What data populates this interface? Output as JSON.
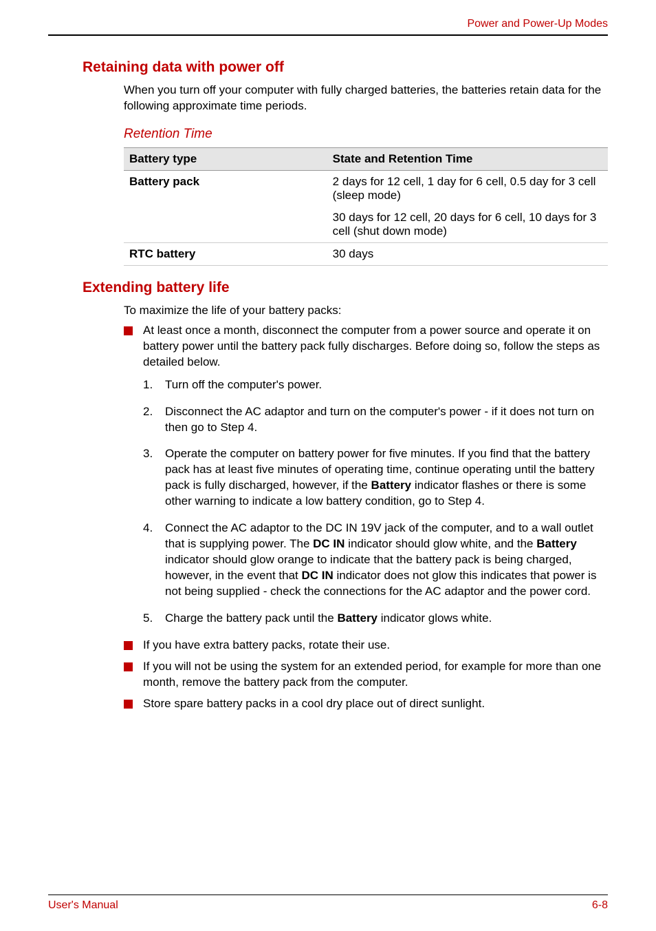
{
  "header": {
    "section_title": "Power and Power-Up Modes"
  },
  "sections": {
    "s1": {
      "heading": "Retaining data with power off",
      "intro": "When you turn off your computer with fully charged batteries, the batteries retain data for the following approximate time periods.",
      "sub_heading": "Retention Time",
      "table": {
        "headers": {
          "c1": "Battery type",
          "c2": "State and Retention Time"
        },
        "rows": {
          "r1": {
            "c1": "Battery pack",
            "c2a": "2 days for 12 cell, 1 day for 6 cell, 0.5 day for 3 cell (sleep mode)",
            "c2b": "30 days for 12 cell, 20 days for 6 cell, 10 days for 3 cell (shut down mode)"
          },
          "r2": {
            "c1": "RTC battery",
            "c2": "30 days"
          }
        }
      }
    },
    "s2": {
      "heading": "Extending battery life",
      "intro": "To maximize the life of your battery packs:",
      "bullets": {
        "b1_pre": "At least once a month, disconnect the computer from a power source and operate it on battery power until the battery pack fully discharges. Before doing so, follow the steps as detailed below.",
        "n1": "Turn off the computer's power.",
        "n2": "Disconnect the AC adaptor and turn on the computer's power - if it does not turn on then go to Step 4.",
        "n3_pre": "Operate the computer on battery power for five minutes. If you find that the battery pack has at least five minutes of operating time, continue operating until the battery pack is fully discharged, however, if the ",
        "n3_bold1": "Battery",
        "n3_post": " indicator flashes or there is some other warning to indicate a low battery condition, go to Step 4.",
        "n4_pre": "Connect the AC adaptor to the DC IN 19V jack of the computer, and to a wall outlet that is supplying power. The ",
        "n4_b1": "DC IN",
        "n4_mid1": " indicator should glow white, and the ",
        "n4_b2": "Battery",
        "n4_mid2": " indicator should glow orange to indicate that the battery pack is being charged, however, in the event that ",
        "n4_b3": "DC IN",
        "n4_post": " indicator does not glow this indicates that power is not being supplied - check the connections for the AC adaptor and the power cord.",
        "n5_pre": "Charge the battery pack until the ",
        "n5_b1": "Battery",
        "n5_post": " indicator glows white.",
        "b2": "If you have extra battery packs, rotate their use.",
        "b3": "If you will not be using the system for an extended period, for example for more than one month, remove the battery pack from the computer.",
        "b4": "Store spare battery packs in a cool dry place out of direct sunlight."
      }
    }
  },
  "footer": {
    "left": "User's Manual",
    "right": "6-8"
  }
}
